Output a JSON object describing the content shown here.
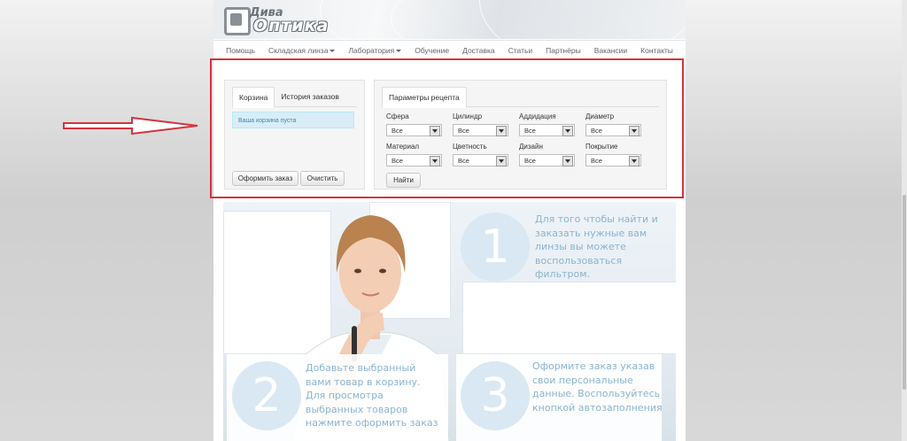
{
  "logo": {
    "top": "Дива",
    "bottom": "Оптика"
  },
  "nav": {
    "items": [
      {
        "label": "Помощь",
        "dropdown": false
      },
      {
        "label": "Складская линза",
        "dropdown": true
      },
      {
        "label": "Лаборатория",
        "dropdown": true
      },
      {
        "label": "Обучение",
        "dropdown": false
      },
      {
        "label": "Доставка",
        "dropdown": false
      },
      {
        "label": "Статьи",
        "dropdown": false
      },
      {
        "label": "Партнёры",
        "dropdown": false
      },
      {
        "label": "Вакансии",
        "dropdown": false
      },
      {
        "label": "Контакты",
        "dropdown": false
      }
    ]
  },
  "cart": {
    "tabs": [
      "Корзина",
      "История заказов"
    ],
    "active_tab": 0,
    "empty_message": "Ваша корзина пуста",
    "order_button": "Оформить заказ",
    "clear_button": "Очистить"
  },
  "filter": {
    "tab": "Параметры рецепта",
    "fields": [
      {
        "label": "Сфера",
        "value": "Все"
      },
      {
        "label": "Цилиндр",
        "value": "Все"
      },
      {
        "label": "Аддидация",
        "value": "Все"
      },
      {
        "label": "Диаметр",
        "value": "Все"
      },
      {
        "label": "Материал",
        "value": "Все"
      },
      {
        "label": "Цветность",
        "value": "Все"
      },
      {
        "label": "Дизайн",
        "value": "Все"
      },
      {
        "label": "Покрытие",
        "value": "Все"
      }
    ],
    "find_button": "Найти"
  },
  "steps": [
    {
      "number": "1",
      "lines": [
        "Для того чтобы найти и",
        "заказать нужные вам",
        "линзы вы можете",
        "воспользоваться",
        "фильтром."
      ]
    },
    {
      "number": "2",
      "lines": [
        "Добавьте выбранный",
        "вами товар в корзину.",
        "Для просмотра",
        "выбранных товаров",
        "нажмите оформить заказ"
      ]
    },
    {
      "number": "3",
      "lines": [
        "Оформите заказ указав",
        "свои персональные",
        "данные. Воспользуйтесь",
        "кнопкой автозаполнения"
      ]
    }
  ],
  "colors": {
    "annotation": "#d2343f",
    "step_text": "#8ab4d0",
    "alert_bg": "#d9edf7"
  }
}
